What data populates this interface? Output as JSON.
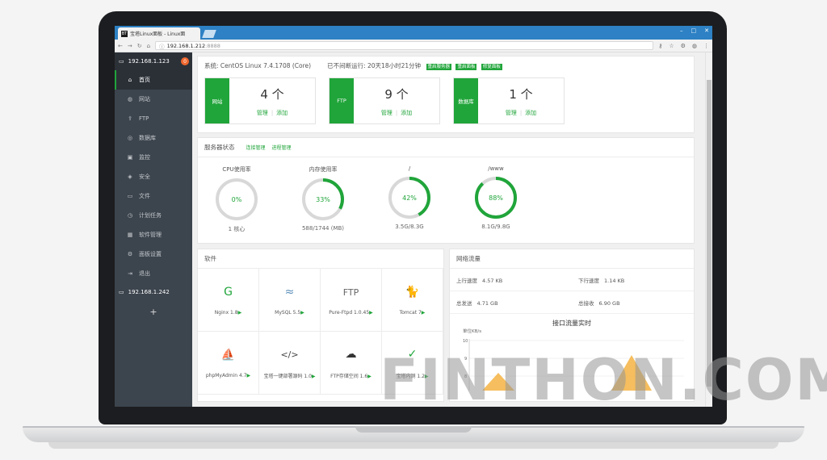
{
  "browser": {
    "tab_title": "宝塔Linux面板 - Linux面",
    "tab_favicon": "BT",
    "url_host": "192.168.1.212",
    "url_port": ":8888",
    "window_controls": [
      "–",
      "□",
      "✕"
    ]
  },
  "sidebar": {
    "server": "192.168.1.123",
    "badge": "0",
    "items": [
      {
        "label": "首页",
        "icon": "home-icon",
        "glyph": "⌂",
        "active": true
      },
      {
        "label": "网站",
        "icon": "globe-icon",
        "glyph": "◍"
      },
      {
        "label": "FTP",
        "icon": "ftp-icon",
        "glyph": "⇪"
      },
      {
        "label": "数据库",
        "icon": "database-icon",
        "glyph": "◎"
      },
      {
        "label": "监控",
        "icon": "monitor-icon",
        "glyph": "▣"
      },
      {
        "label": "安全",
        "icon": "shield-icon",
        "glyph": "◈"
      },
      {
        "label": "文件",
        "icon": "folder-icon",
        "glyph": "▭"
      },
      {
        "label": "计划任务",
        "icon": "clock-icon",
        "glyph": "◷"
      },
      {
        "label": "软件管理",
        "icon": "grid-icon",
        "glyph": "▦"
      },
      {
        "label": "面板设置",
        "icon": "gear-icon",
        "glyph": "⚙"
      },
      {
        "label": "退出",
        "icon": "logout-icon",
        "glyph": "⇥"
      }
    ],
    "server2": "192.168.1.242",
    "add": "+"
  },
  "system": {
    "os": "系统: CentOS Linux 7.4.1708 (Core)",
    "uptime": "已不间断运行: 20天18小时21分钟",
    "buttons": [
      "重启服务器",
      "重启面板",
      "修复面板"
    ]
  },
  "cards": [
    {
      "label": "网站",
      "count": "4 个",
      "manage": "管理",
      "add": "添加"
    },
    {
      "label": "FTP",
      "count": "9 个",
      "manage": "管理",
      "add": "添加"
    },
    {
      "label": "数据库",
      "count": "1 个",
      "manage": "管理",
      "add": "添加"
    }
  ],
  "status": {
    "title": "服务器状态",
    "links": [
      "连接管理",
      "进程管理"
    ],
    "gauges": [
      {
        "title": "CPU使用率",
        "pct": "0%",
        "value": 0.0,
        "under": "1 核心"
      },
      {
        "title": "内存使用率",
        "pct": "33%",
        "value": 0.33,
        "under": "588/1744 (MB)"
      },
      {
        "title": "/",
        "pct": "42%",
        "value": 0.42,
        "under": "3.5G/8.3G"
      },
      {
        "title": "/www",
        "pct": "88%",
        "value": 0.88,
        "under": "8.1G/9.8G"
      }
    ]
  },
  "software": {
    "title": "软件",
    "items": [
      {
        "name": "Nginx 1.8",
        "icon": "nginx-icon",
        "glyph": "G",
        "color": "#20a53a"
      },
      {
        "name": "MySQL 5.5",
        "icon": "mysql-dolphin-icon",
        "glyph": "≈",
        "color": "#5b8fb9"
      },
      {
        "name": "Pure-Ftpd 1.0.45",
        "icon": "ftp-icon",
        "glyph": "FTP",
        "color": "#666666"
      },
      {
        "name": "Tomcat 7",
        "icon": "tomcat-icon",
        "glyph": "🐈",
        "color": "#d8a03a"
      },
      {
        "name": "phpMyAdmin 4.7",
        "icon": "phpmyadmin-icon",
        "glyph": "⛵",
        "color": "#e8a33a"
      },
      {
        "name": "宝塔一键部署源码 1.0",
        "icon": "code-icon",
        "glyph": "</>",
        "color": "#444444"
      },
      {
        "name": "FTP存储空间 1.6",
        "icon": "cloud-ftp-icon",
        "glyph": "☁",
        "color": "#333333"
      },
      {
        "name": "宝塔内测 1.2",
        "icon": "clipboard-icon",
        "glyph": "✓",
        "color": "#20a53a"
      }
    ]
  },
  "network": {
    "title": "网络流量",
    "upload_label": "上行速度",
    "upload": "4.57 KB",
    "download_label": "下行速度",
    "download": "1.14 KB",
    "total_sent_label": "总发送",
    "total_sent": "4.71 GB",
    "total_recv_label": "总接收",
    "total_recv": "6.90 GB",
    "chart_title": "接口流量实时",
    "unit": "单位KB/s",
    "y_ticks": [
      "10",
      "9",
      "8"
    ]
  },
  "watermark": "FINTHON.COM",
  "colors": {
    "accent": "#20a53a",
    "sidebar": "#3c444d",
    "chrome": "#2d81c4"
  }
}
